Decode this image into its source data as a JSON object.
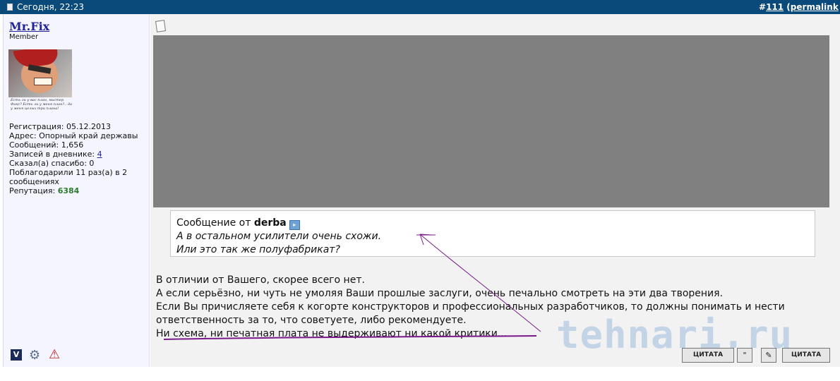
{
  "header": {
    "date": "Сегодня, 22:23",
    "post_hash": "#",
    "post_number": "111",
    "permalink_open": " (",
    "permalink": "permalink"
  },
  "user": {
    "name": "Mr.Fix",
    "title": "Member",
    "avatar_caption": "Есть ли у вас план, мистер Фикс? Есть ли у меня план?.. да у меня целых три плана!",
    "registration": "Регистрация: 05.12.2013",
    "address": "Адрес: Опорный край державы",
    "messages": "Сообщений: 1,656",
    "diary_label": "Записей в дневнике: ",
    "diary_count": "4",
    "thanks_said": "Сказал(а) спасибо: 0",
    "thanked_line1": "Поблагодарили 11 раз(а) в 2",
    "thanked_line2": "сообщениях",
    "reputation_label": "Репутация: ",
    "reputation_value": "6384"
  },
  "user_icons": [
    "v-icon",
    "gear-icon",
    "warning-icon"
  ],
  "quote": {
    "prefix": "Сообщение от ",
    "author": "derba",
    "line1": "А в остальном усилители очень схожи.",
    "line2": "Или это так же полуфабрикат?"
  },
  "message": {
    "line1": "В отличии от Вашего, скорее всего нет.",
    "line2": "А если серьёзно, ни чуть не умоляя Ваши прошлые заслуги, очень печально смотреть на эти два творения.",
    "line3": "Если Вы причисляете себя к когорте конструкторов и профессиональных разработчиков, то должны понимать и нести",
    "line4": "ответственность за то, что советуете, либо рекомендуете.",
    "line5": "Ни схема, ни печатная плата не выдерживают ни какой критики..."
  },
  "watermark": "tehnari.ru",
  "buttons": {
    "quote1": "ЦИТАТА",
    "quote2": "ЦИТАТА",
    "multiquote_icon": "\"",
    "reply_icon": "✎"
  },
  "colors": {
    "header_bg": "#0a4a7a",
    "annotation": "#7a1a8a",
    "reputation": "#2c7a2c",
    "link": "#22229c"
  }
}
